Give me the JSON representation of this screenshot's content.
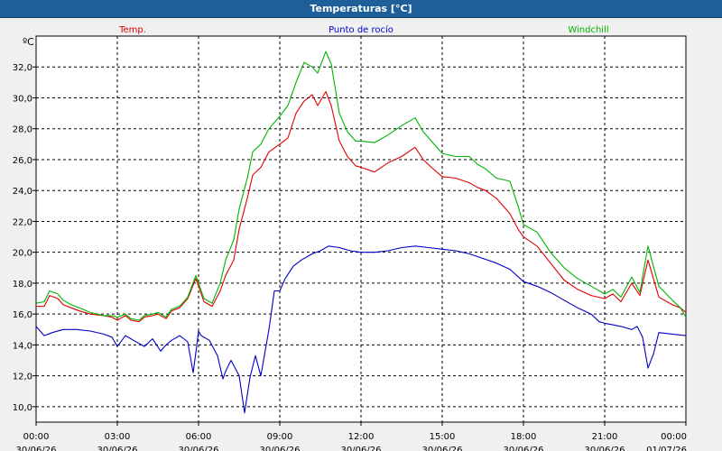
{
  "window": {
    "title": "Temperaturas [°C]"
  },
  "chart_data": {
    "type": "line",
    "title": "Temperaturas [°C]",
    "ylabel": "ºC",
    "xlabel": "",
    "ylim": [
      9.0,
      34.0
    ],
    "y_ticks": [
      10.0,
      12.0,
      14.0,
      16.0,
      18.0,
      20.0,
      22.0,
      24.0,
      26.0,
      28.0,
      30.0,
      32.0
    ],
    "y_tick_labels": [
      "10,0",
      "12,0",
      "14,0",
      "16,0",
      "18,0",
      "20,0",
      "22,0",
      "24,0",
      "26,0",
      "28,0",
      "30,0",
      "32,0"
    ],
    "xlim": [
      0,
      24
    ],
    "x_ticks": [
      {
        "time": "00:00",
        "date": "30/06/26"
      },
      {
        "time": "03:00",
        "date": "30/06/26"
      },
      {
        "time": "06:00",
        "date": "30/06/26"
      },
      {
        "time": "09:00",
        "date": "30/06/26"
      },
      {
        "time": "12:00",
        "date": "30/06/26"
      },
      {
        "time": "15:00",
        "date": "30/06/26"
      },
      {
        "time": "18:00",
        "date": "30/06/26"
      },
      {
        "time": "21:00",
        "date": "30/06/26"
      },
      {
        "time": "00:00",
        "date": "01/07/26"
      }
    ],
    "grid": true,
    "legend_position": "top",
    "series": [
      {
        "name": "Temp.",
        "color": "#e00000",
        "x": [
          0.0,
          0.3,
          0.5,
          0.8,
          1.0,
          1.3,
          1.6,
          2.0,
          2.5,
          2.8,
          3.0,
          3.3,
          3.5,
          3.8,
          4.0,
          4.3,
          4.5,
          4.8,
          5.0,
          5.3,
          5.6,
          5.9,
          6.2,
          6.5,
          6.8,
          7.0,
          7.3,
          7.5,
          7.8,
          8.0,
          8.3,
          8.6,
          9.0,
          9.3,
          9.6,
          9.9,
          10.2,
          10.4,
          10.7,
          10.9,
          11.2,
          11.5,
          11.8,
          12.0,
          12.5,
          13.0,
          13.5,
          14.0,
          14.3,
          14.6,
          15.0,
          15.5,
          16.0,
          16.3,
          16.6,
          17.0,
          17.5,
          17.8,
          18.0,
          18.5,
          19.0,
          19.5,
          20.0,
          20.5,
          21.0,
          21.3,
          21.6,
          22.0,
          22.3,
          22.6,
          23.0,
          23.5,
          23.8,
          24.0
        ],
        "y": [
          16.5,
          16.5,
          17.2,
          17.0,
          16.6,
          16.4,
          16.2,
          16.0,
          15.9,
          15.8,
          15.6,
          15.9,
          15.6,
          15.5,
          15.8,
          15.9,
          16.0,
          15.7,
          16.2,
          16.4,
          17.0,
          18.3,
          16.8,
          16.5,
          17.5,
          18.5,
          19.5,
          21.5,
          23.5,
          25.0,
          25.5,
          26.5,
          27.0,
          27.4,
          29.0,
          29.8,
          30.2,
          29.5,
          30.4,
          29.5,
          27.2,
          26.2,
          25.6,
          25.5,
          25.2,
          25.8,
          26.2,
          26.8,
          26.0,
          25.5,
          24.9,
          24.8,
          24.5,
          24.2,
          24.0,
          23.5,
          22.5,
          21.5,
          21.0,
          20.4,
          19.3,
          18.2,
          17.6,
          17.2,
          17.0,
          17.3,
          16.8,
          18.0,
          17.2,
          19.5,
          17.1,
          16.6,
          16.4,
          16.1
        ]
      },
      {
        "name": "Punto de rocío",
        "color": "#0000c8",
        "x": [
          0.0,
          0.3,
          0.6,
          1.0,
          1.5,
          2.0,
          2.5,
          2.8,
          3.0,
          3.3,
          3.6,
          4.0,
          4.3,
          4.6,
          4.8,
          5.0,
          5.3,
          5.6,
          5.8,
          5.9,
          6.0,
          6.1,
          6.4,
          6.7,
          6.9,
          7.0,
          7.2,
          7.5,
          7.7,
          7.9,
          8.1,
          8.3,
          8.6,
          8.8,
          9.0,
          9.2,
          9.5,
          9.8,
          10.2,
          10.5,
          10.8,
          11.2,
          11.6,
          12.0,
          12.5,
          13.0,
          13.5,
          14.0,
          14.5,
          15.0,
          15.5,
          16.0,
          16.5,
          17.0,
          17.5,
          18.0,
          18.5,
          19.0,
          19.5,
          20.0,
          20.5,
          20.8,
          21.0,
          21.3,
          21.6,
          22.0,
          22.2,
          22.4,
          22.6,
          22.8,
          23.0,
          23.5,
          24.0
        ],
        "y": [
          15.2,
          14.6,
          14.8,
          15.0,
          15.0,
          14.9,
          14.7,
          14.5,
          13.9,
          14.6,
          14.3,
          13.9,
          14.4,
          13.6,
          14.0,
          14.3,
          14.6,
          14.2,
          12.2,
          13.5,
          14.9,
          14.6,
          14.3,
          13.3,
          11.8,
          12.3,
          13.0,
          12.0,
          9.6,
          11.9,
          13.3,
          12.0,
          15.0,
          17.5,
          17.5,
          18.3,
          19.1,
          19.5,
          19.9,
          20.1,
          20.4,
          20.3,
          20.1,
          20.0,
          20.0,
          20.1,
          20.3,
          20.4,
          20.3,
          20.2,
          20.1,
          19.9,
          19.6,
          19.3,
          18.9,
          18.1,
          17.8,
          17.4,
          16.9,
          16.4,
          16.0,
          15.5,
          15.4,
          15.3,
          15.2,
          15.0,
          15.2,
          14.5,
          12.5,
          13.4,
          14.8,
          14.7,
          14.6
        ]
      },
      {
        "name": "Windchill",
        "color": "#00b400",
        "x": [
          0.0,
          0.3,
          0.5,
          0.8,
          1.0,
          1.3,
          1.6,
          2.0,
          2.5,
          2.8,
          3.0,
          3.3,
          3.5,
          3.8,
          4.0,
          4.3,
          4.5,
          4.8,
          5.0,
          5.3,
          5.6,
          5.9,
          6.2,
          6.5,
          6.8,
          7.0,
          7.3,
          7.5,
          7.8,
          8.0,
          8.3,
          8.6,
          9.0,
          9.3,
          9.6,
          9.9,
          10.2,
          10.4,
          10.7,
          10.9,
          11.2,
          11.5,
          11.8,
          12.0,
          12.5,
          13.0,
          13.5,
          14.0,
          14.3,
          14.6,
          15.0,
          15.5,
          16.0,
          16.3,
          16.6,
          17.0,
          17.5,
          17.8,
          18.0,
          18.5,
          19.0,
          19.5,
          20.0,
          20.5,
          21.0,
          21.3,
          21.6,
          22.0,
          22.3,
          22.6,
          23.0,
          23.5,
          23.8,
          24.0
        ],
        "y": [
          16.7,
          16.8,
          17.5,
          17.3,
          16.9,
          16.6,
          16.4,
          16.1,
          15.9,
          15.9,
          15.8,
          16.0,
          15.7,
          15.6,
          15.9,
          16.0,
          16.1,
          15.8,
          16.3,
          16.5,
          17.1,
          18.5,
          17.0,
          16.7,
          18.0,
          19.5,
          20.8,
          22.8,
          24.8,
          26.5,
          27.0,
          28.0,
          28.8,
          29.5,
          31.0,
          32.3,
          32.0,
          31.6,
          33.0,
          32.2,
          29.0,
          27.8,
          27.2,
          27.2,
          27.1,
          27.6,
          28.2,
          28.7,
          27.8,
          27.2,
          26.4,
          26.2,
          26.2,
          25.7,
          25.4,
          24.8,
          24.6,
          23.0,
          21.8,
          21.3,
          20.0,
          19.0,
          18.3,
          17.8,
          17.3,
          17.6,
          17.1,
          18.4,
          17.4,
          20.4,
          17.8,
          16.9,
          16.4,
          15.8
        ]
      }
    ]
  }
}
